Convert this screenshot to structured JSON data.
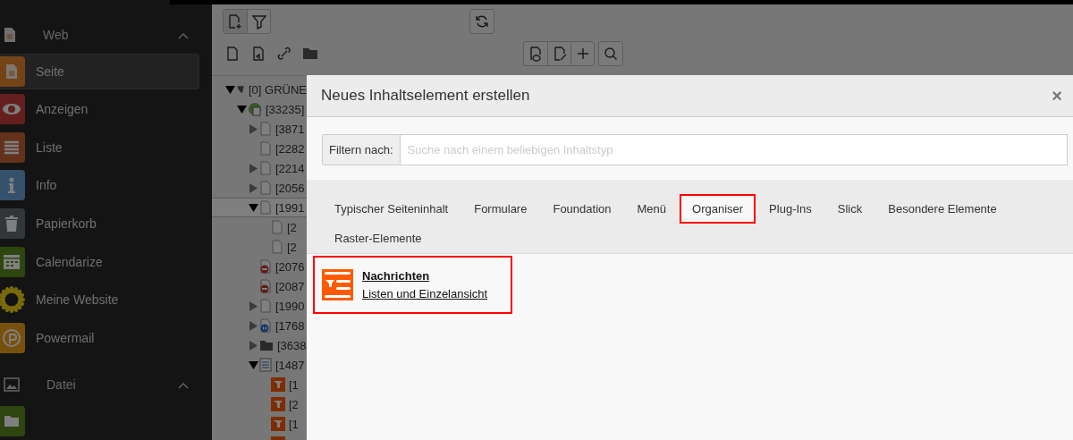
{
  "sidebar": {
    "groups": [
      {
        "label": "Web",
        "expanded": true,
        "kind": "page",
        "items": [
          {
            "label": "Seite",
            "selected": true,
            "kind": "page"
          },
          {
            "label": "Anzeigen",
            "selected": false,
            "kind": "eye"
          },
          {
            "label": "Liste",
            "selected": false,
            "kind": "list"
          },
          {
            "label": "Info",
            "selected": false,
            "kind": "info"
          },
          {
            "label": "Papierkorb",
            "selected": false,
            "kind": "trash"
          },
          {
            "label": "Calendarize",
            "selected": false,
            "kind": "calendar"
          },
          {
            "label": "Meine Website",
            "selected": false,
            "kind": "sunflower"
          },
          {
            "label": "Powermail",
            "selected": false,
            "kind": "powermail"
          }
        ]
      },
      {
        "label": "Datei",
        "expanded": true,
        "kind": "image",
        "items": [
          {
            "selected": false,
            "kind": "folder"
          }
        ]
      }
    ]
  },
  "tree": [
    {
      "label": "[0] GRÜNE",
      "kind": "root",
      "expanded": true,
      "selected": false,
      "children": [
        {
          "label": "[33235]",
          "kind": "site",
          "expanded": true,
          "selected": false,
          "children": [
            {
              "label": "[3871",
              "kind": "page",
              "expanded": false,
              "selected": false
            },
            {
              "label": "[2282",
              "kind": "page",
              "selected": false
            },
            {
              "label": "[2214",
              "kind": "page",
              "expanded": false,
              "selected": false
            },
            {
              "label": "[2056",
              "kind": "page",
              "expanded": false,
              "selected": false
            },
            {
              "label": "[1991",
              "kind": "page",
              "expanded": true,
              "selected": true,
              "children": [
                {
                  "label": "[2",
                  "kind": "page",
                  "selected": false
                },
                {
                  "label": "[2",
                  "kind": "page",
                  "selected": false
                }
              ]
            },
            {
              "label": "[2076",
              "kind": "hidden",
              "selected": false
            },
            {
              "label": "[2087",
              "kind": "hidden",
              "selected": false
            },
            {
              "label": "[1990",
              "kind": "page",
              "expanded": false,
              "selected": false
            },
            {
              "label": "[1768",
              "kind": "shortcut",
              "expanded": false,
              "selected": false
            },
            {
              "label": "[3638",
              "kind": "folder",
              "expanded": false,
              "selected": false
            },
            {
              "label": "[1487",
              "kind": "sysfolder",
              "expanded": true,
              "selected": false,
              "children": [
                {
                  "label": "[1",
                  "kind": "news",
                  "selected": false
                },
                {
                  "label": "[2",
                  "kind": "news",
                  "selected": false
                },
                {
                  "label": "[1",
                  "kind": "news",
                  "selected": false
                },
                {
                  "kind": "news",
                  "selected": false
                }
              ]
            }
          ]
        }
      ]
    }
  ],
  "dialog": {
    "title": "Neues Inhaltselement erstellen",
    "close": "×",
    "filter": {
      "label": "Filtern nach:",
      "placeholder": "Suche nach einem beliebigen Inhaltstyp"
    },
    "tabs": [
      {
        "label": "Typischer Seiteninhalt",
        "selected": false,
        "highlighted": false
      },
      {
        "label": "Formulare",
        "selected": false,
        "highlighted": false
      },
      {
        "label": "Foundation",
        "selected": false,
        "highlighted": false
      },
      {
        "label": "Menü",
        "selected": false,
        "highlighted": false
      },
      {
        "label": "Organiser",
        "selected": true,
        "highlighted": true
      },
      {
        "label": "Plug-Ins",
        "selected": false,
        "highlighted": false
      },
      {
        "label": "Slick",
        "selected": false,
        "highlighted": false
      },
      {
        "label": "Besondere Elemente",
        "selected": false,
        "highlighted": false
      },
      {
        "label": "Raster-Elemente",
        "selected": false,
        "highlighted": false
      }
    ],
    "elements": [
      {
        "title": "Nachrichten",
        "description": "Listen und Einzelansicht",
        "highlighted": true
      }
    ]
  }
}
